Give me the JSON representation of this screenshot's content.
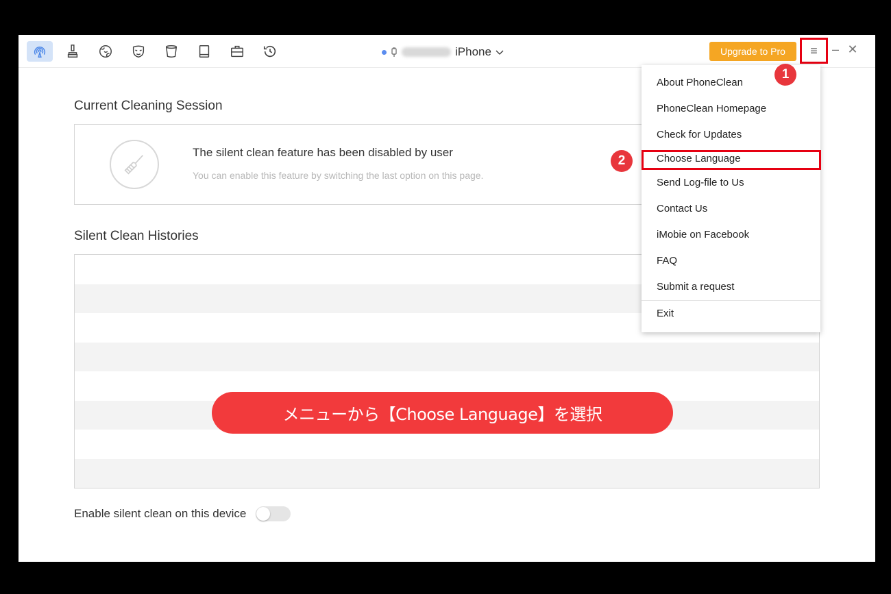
{
  "toolbar": {
    "tools": [
      {
        "name": "silent-clean-icon",
        "active": true
      },
      {
        "name": "quick-clean-icon",
        "active": false
      },
      {
        "name": "internet-clean-icon",
        "active": false
      },
      {
        "name": "privacy-clean-icon",
        "active": false
      },
      {
        "name": "system-clean-icon",
        "active": false
      },
      {
        "name": "book-icon",
        "active": false
      },
      {
        "name": "toolbox-icon",
        "active": false
      },
      {
        "name": "history-icon",
        "active": false
      }
    ],
    "device_name": "iPhone",
    "upgrade_label": "Upgrade to Pro",
    "menu_glyph": "≡",
    "minimize_glyph": "–",
    "close_glyph": "✕"
  },
  "session": {
    "title": "Current Cleaning Session",
    "main_text": "The silent clean feature has been disabled by user",
    "sub_text": "You can enable this feature by switching the last option on this page."
  },
  "histories": {
    "title": "Silent Clean Histories"
  },
  "enable": {
    "label": "Enable silent clean on this device",
    "on": false
  },
  "menu": {
    "items": [
      "About PhoneClean",
      "PhoneClean Homepage",
      "Check for Updates",
      "Choose Language",
      "Send Log-file to Us",
      "Contact Us",
      "iMobie on Facebook",
      "FAQ",
      "Submit a request",
      "Exit"
    ]
  },
  "annotations": {
    "step1": "1",
    "step2": "2",
    "banner": "メニューから【Choose Language】を選択",
    "highlight_color": "#e60012",
    "banner_color": "#f23a3c"
  },
  "colors": {
    "accent": "#5b8def",
    "upgrade": "#f5a623"
  }
}
